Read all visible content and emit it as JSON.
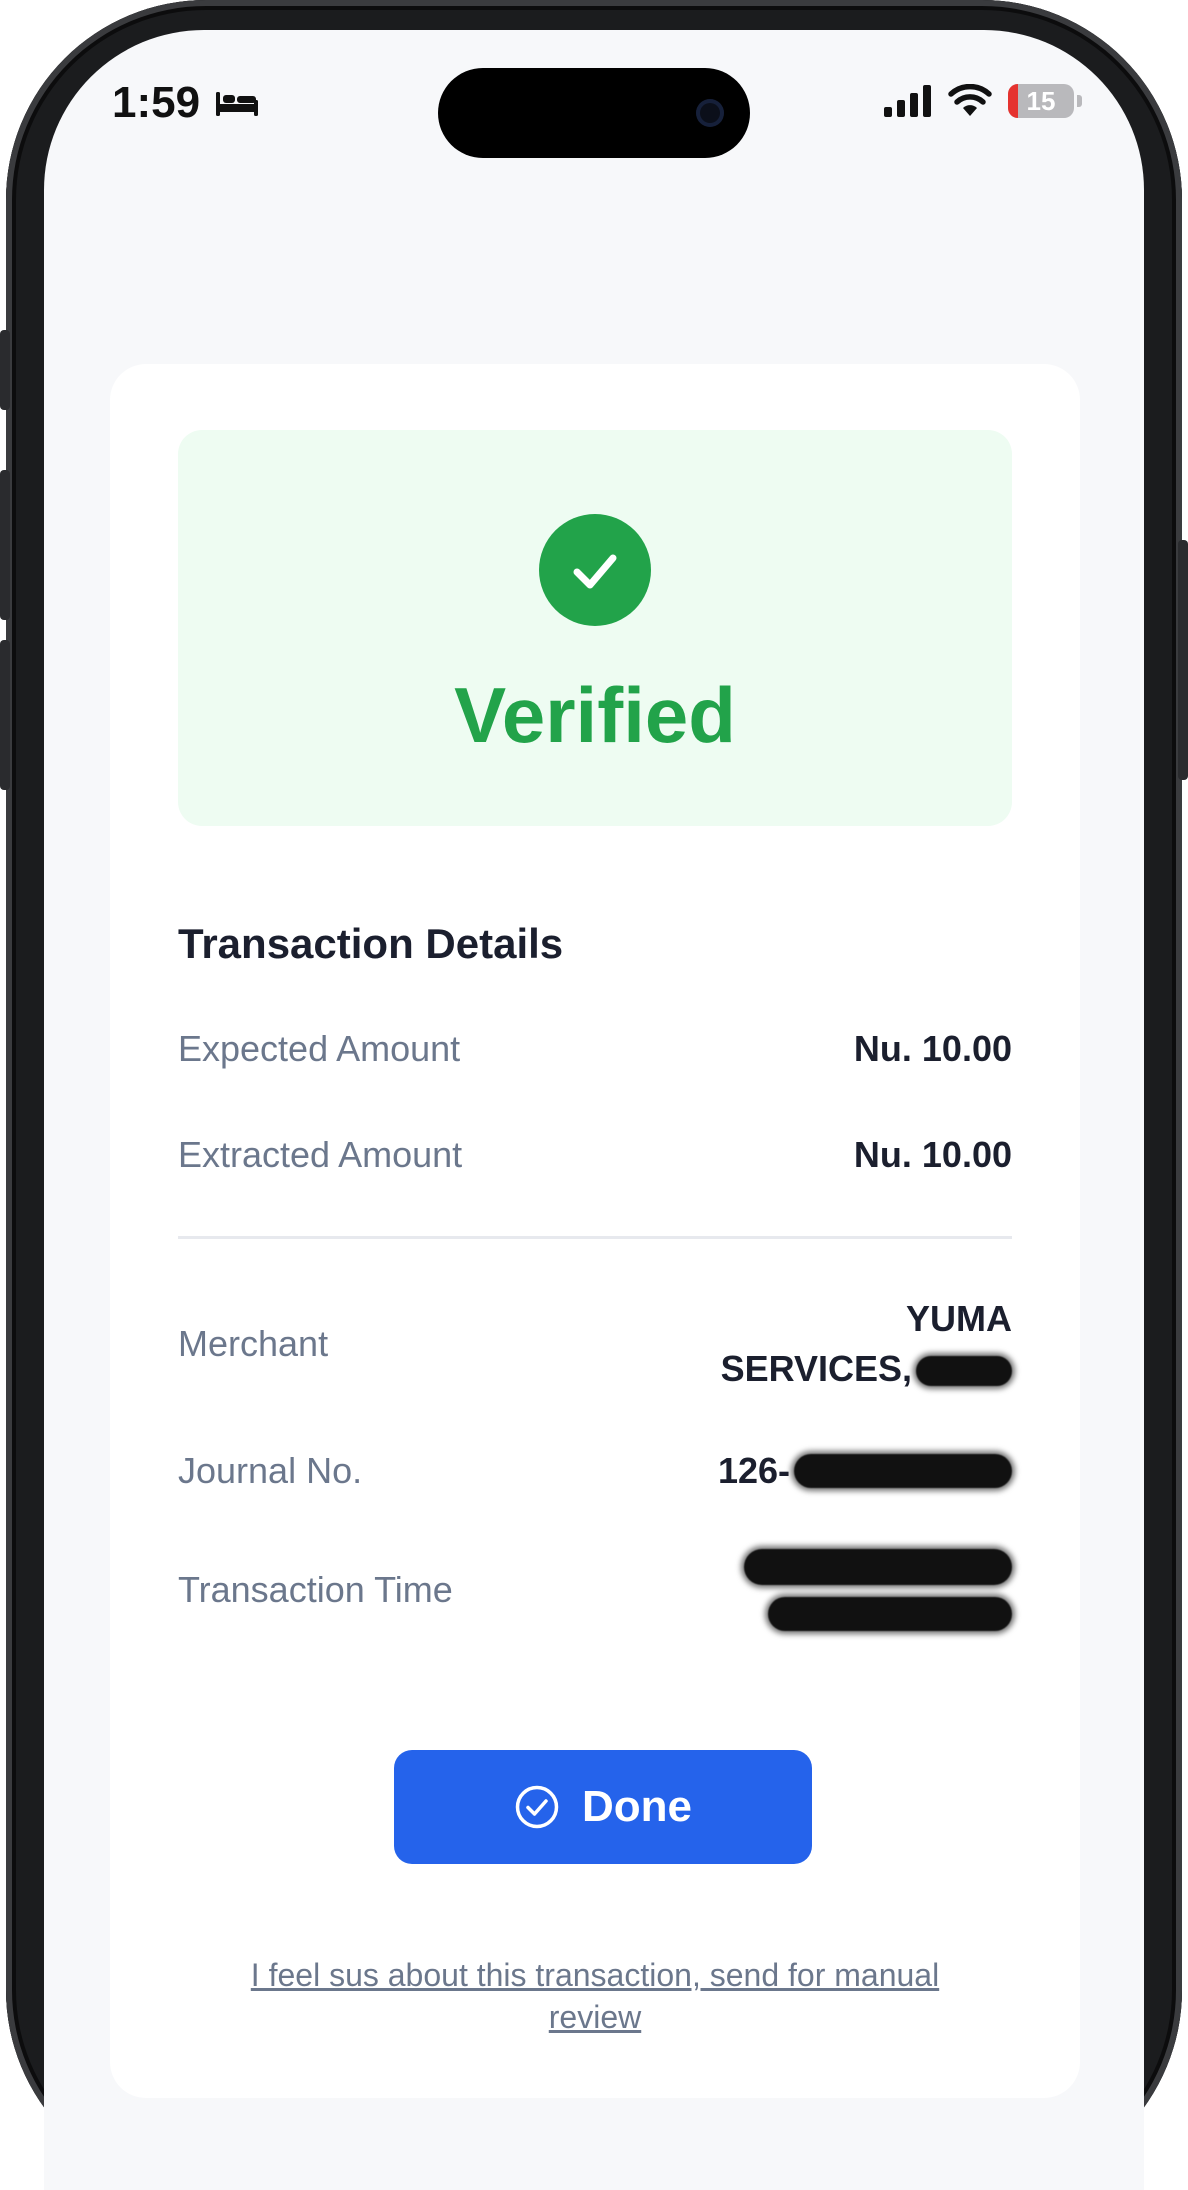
{
  "status_bar": {
    "time": "1:59",
    "battery_level": "15"
  },
  "result": {
    "status_label": "Verified",
    "status_color": "#22a34a"
  },
  "details": {
    "title": "Transaction Details",
    "expected_amount_label": "Expected Amount",
    "expected_amount_value": "Nu. 10.00",
    "extracted_amount_label": "Extracted Amount",
    "extracted_amount_value": "Nu. 10.00",
    "merchant_label": "Merchant",
    "merchant_value_line1": "YUMA",
    "merchant_value_line2_visible": "SERVICES,",
    "journal_label": "Journal No.",
    "journal_value_visible": "126-",
    "transaction_time_label": "Transaction Time"
  },
  "actions": {
    "done_label": "Done",
    "done_color": "#2563eb",
    "review_link_label": "I feel sus about this transaction, send for manual review"
  }
}
